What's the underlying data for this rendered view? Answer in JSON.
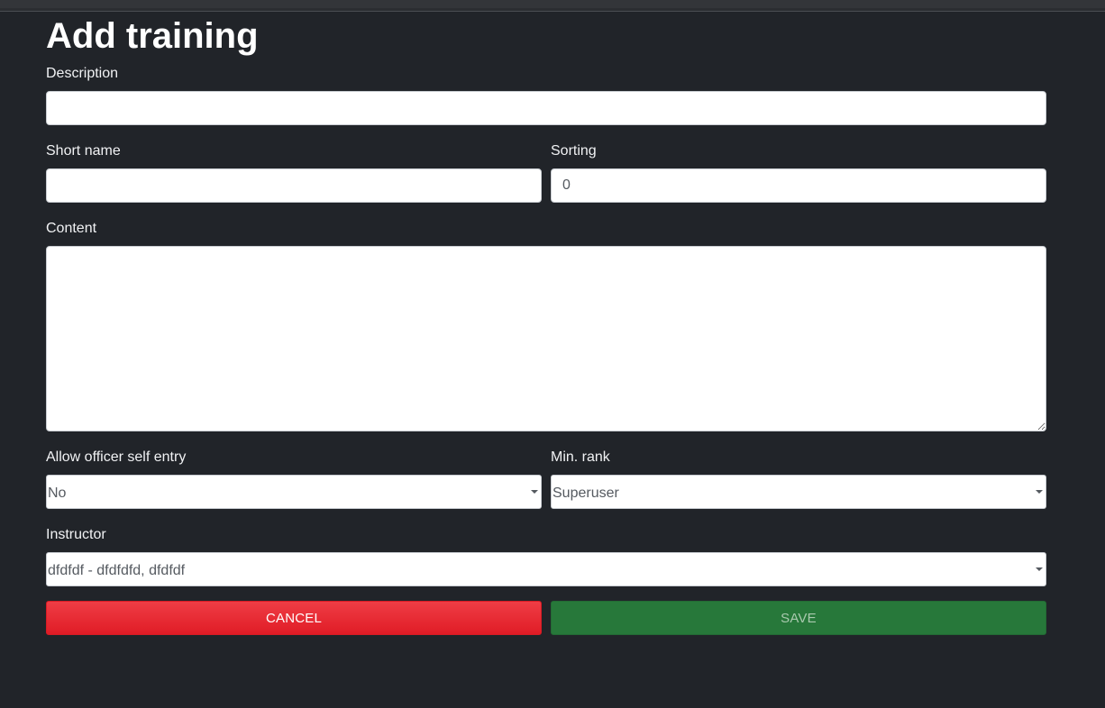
{
  "page": {
    "title": "Add training"
  },
  "form": {
    "description_label": "Description",
    "description_value": "",
    "short_name_label": "Short name",
    "short_name_value": "",
    "sorting_label": "Sorting",
    "sorting_value": "0",
    "content_label": "Content",
    "content_value": "",
    "self_entry_label": "Allow officer self entry",
    "self_entry_value": "No",
    "min_rank_label": "Min. rank",
    "min_rank_value": "Superuser",
    "instructor_label": "Instructor",
    "instructor_value": "dfdfdf - dfdfdfd, dfdfdf"
  },
  "actions": {
    "cancel_label": "CANCEL",
    "save_label": "SAVE"
  },
  "colors": {
    "background": "#212429",
    "cancel": "#e8252e",
    "save": "#27783a"
  },
  "icons": {
    "select_caret": "chevron-down-icon"
  }
}
